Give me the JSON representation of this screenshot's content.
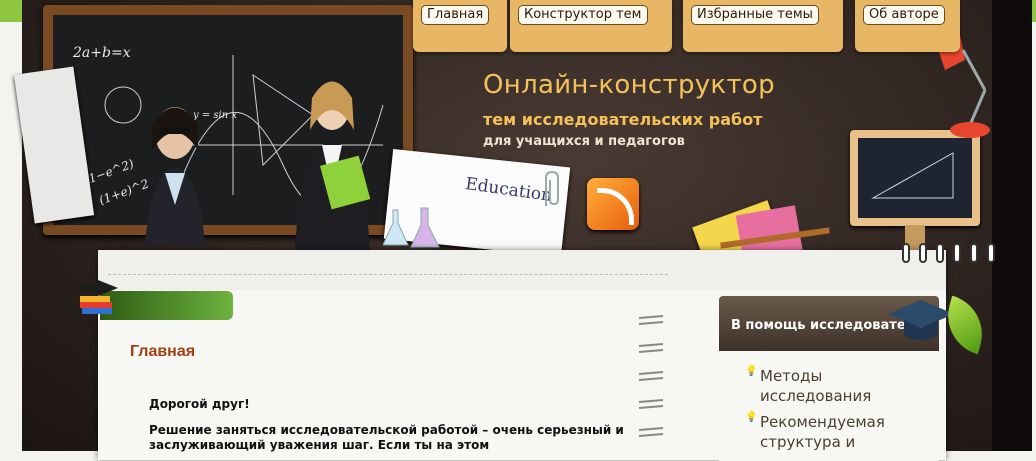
{
  "nav": {
    "items": [
      "Главная",
      "Конструктор тем",
      "Избранные темы",
      "Об авторе"
    ]
  },
  "header": {
    "title": "Онлайн-конструктор",
    "subtitle": "тем исследовательских работ",
    "tagline": "для учащихся и педагогов"
  },
  "decor": {
    "education_label": "Education",
    "chalk": [
      "2a+b=x",
      "(1−e^2)",
      "(1+e)^2",
      "y = sin x"
    ]
  },
  "main": {
    "page_title": "Главная",
    "greeting": "Дорогой друг!",
    "intro": "Решение заняться исследовательской работой – очень серьезный и заслуживающий уважения шаг. Если ты на этом"
  },
  "sidebar": {
    "title": "В помощь исследователю",
    "items": [
      "Методы исследования",
      "Рекомендуемая структура и"
    ]
  },
  "colors": {
    "accent_green": "#8ec63f",
    "title_gold": "#f4c15a",
    "heading_brown": "#a04012",
    "tab_tan": "#e8b766"
  }
}
